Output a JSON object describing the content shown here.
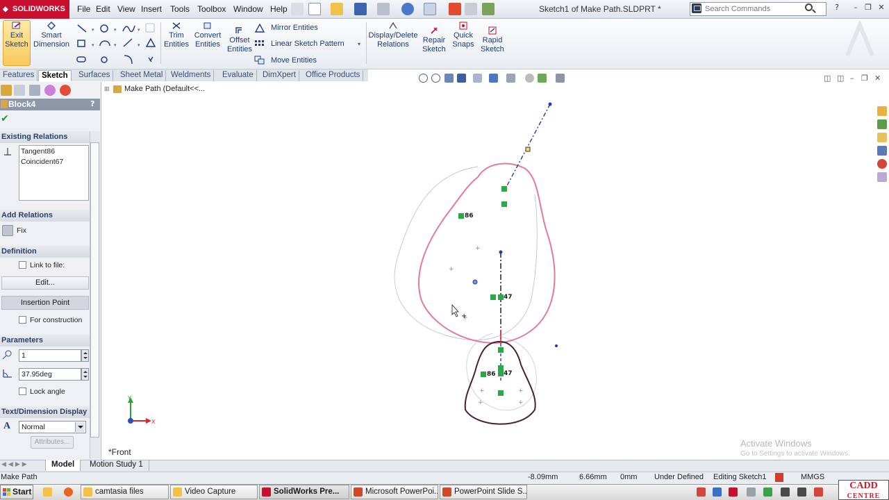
{
  "app": {
    "brand": "SOLIDWORKS",
    "document_title": "Sketch1 of Make Path.SLDPRT *"
  },
  "menu": [
    "File",
    "Edit",
    "View",
    "Insert",
    "Tools",
    "Toolbox",
    "Window",
    "Help"
  ],
  "search": {
    "placeholder": "Search Commands"
  },
  "commands": {
    "exit_sketch": "Exit Sketch",
    "smart_dimension": "Smart Dimension",
    "trim_entities": "Trim Entities",
    "convert_entities": "Convert Entities",
    "offset_entities": "Offset Entities",
    "mirror_entities": "Mirror Entities",
    "linear_sketch_pattern": "Linear Sketch Pattern",
    "move_entities": "Move Entities",
    "display_delete_relations": "Display/Delete Relations",
    "repair_sketch": "Repair Sketch",
    "quick_snaps": "Quick Snaps",
    "rapid_sketch": "Rapid Sketch"
  },
  "tabs": [
    "Features",
    "Sketch",
    "Surfaces",
    "Sheet Metal",
    "Weldments",
    "Evaluate",
    "DimXpert",
    "Office Products"
  ],
  "active_tab": "Sketch",
  "property_manager": {
    "title": "Block4",
    "help": "?",
    "existing_relations_label": "Existing Relations",
    "relations": [
      "Tangent86",
      "Coincident67"
    ],
    "add_relations_label": "Add Relations",
    "fix_label": "Fix",
    "definition_label": "Definition",
    "link_to_file_label": "Link to file:",
    "edit_label": "Edit...",
    "insertion_point_label": "Insertion Point",
    "for_construction_label": "For construction",
    "parameters_label": "Parameters",
    "scale_value": "1",
    "angle_value": "37.95deg",
    "lock_angle_label": "Lock angle",
    "text_dimension_label": "Text/Dimension Display",
    "font_value": "Normal",
    "attributes_label": "Attributes..."
  },
  "graphics": {
    "tree_flyout": "Make Path  (Default<<...",
    "view_label": "*Front",
    "relation_tags": [
      "86",
      "47",
      "86",
      "47"
    ],
    "watermark_title": "Activate Windows",
    "watermark_sub": "Go to Settings to activate Windows."
  },
  "bottom_tabs": [
    "Model",
    "Motion Study 1"
  ],
  "status": {
    "file": "Make Path",
    "x": "-8.09mm",
    "y": "6.66mm",
    "z": "0mm",
    "definition": "Under Defined",
    "mode": "Editing Sketch1",
    "units": "MMGS"
  },
  "taskbar": {
    "start": "Start",
    "items": [
      "camtasia files",
      "Video Capture",
      "SolidWorks Pre...",
      "Microsoft PowerPoi...",
      "PowerPoint Slide S..."
    ],
    "active_item": "SolidWorks Pre..."
  },
  "corner_logo": {
    "line1": "CADD",
    "line2": "CENTRE"
  },
  "colors": {
    "accent_red": "#c8102e",
    "sketch_pink": "#e4799c",
    "sketch_dark": "#4a1f33",
    "relation_green": "#2aa84a"
  }
}
